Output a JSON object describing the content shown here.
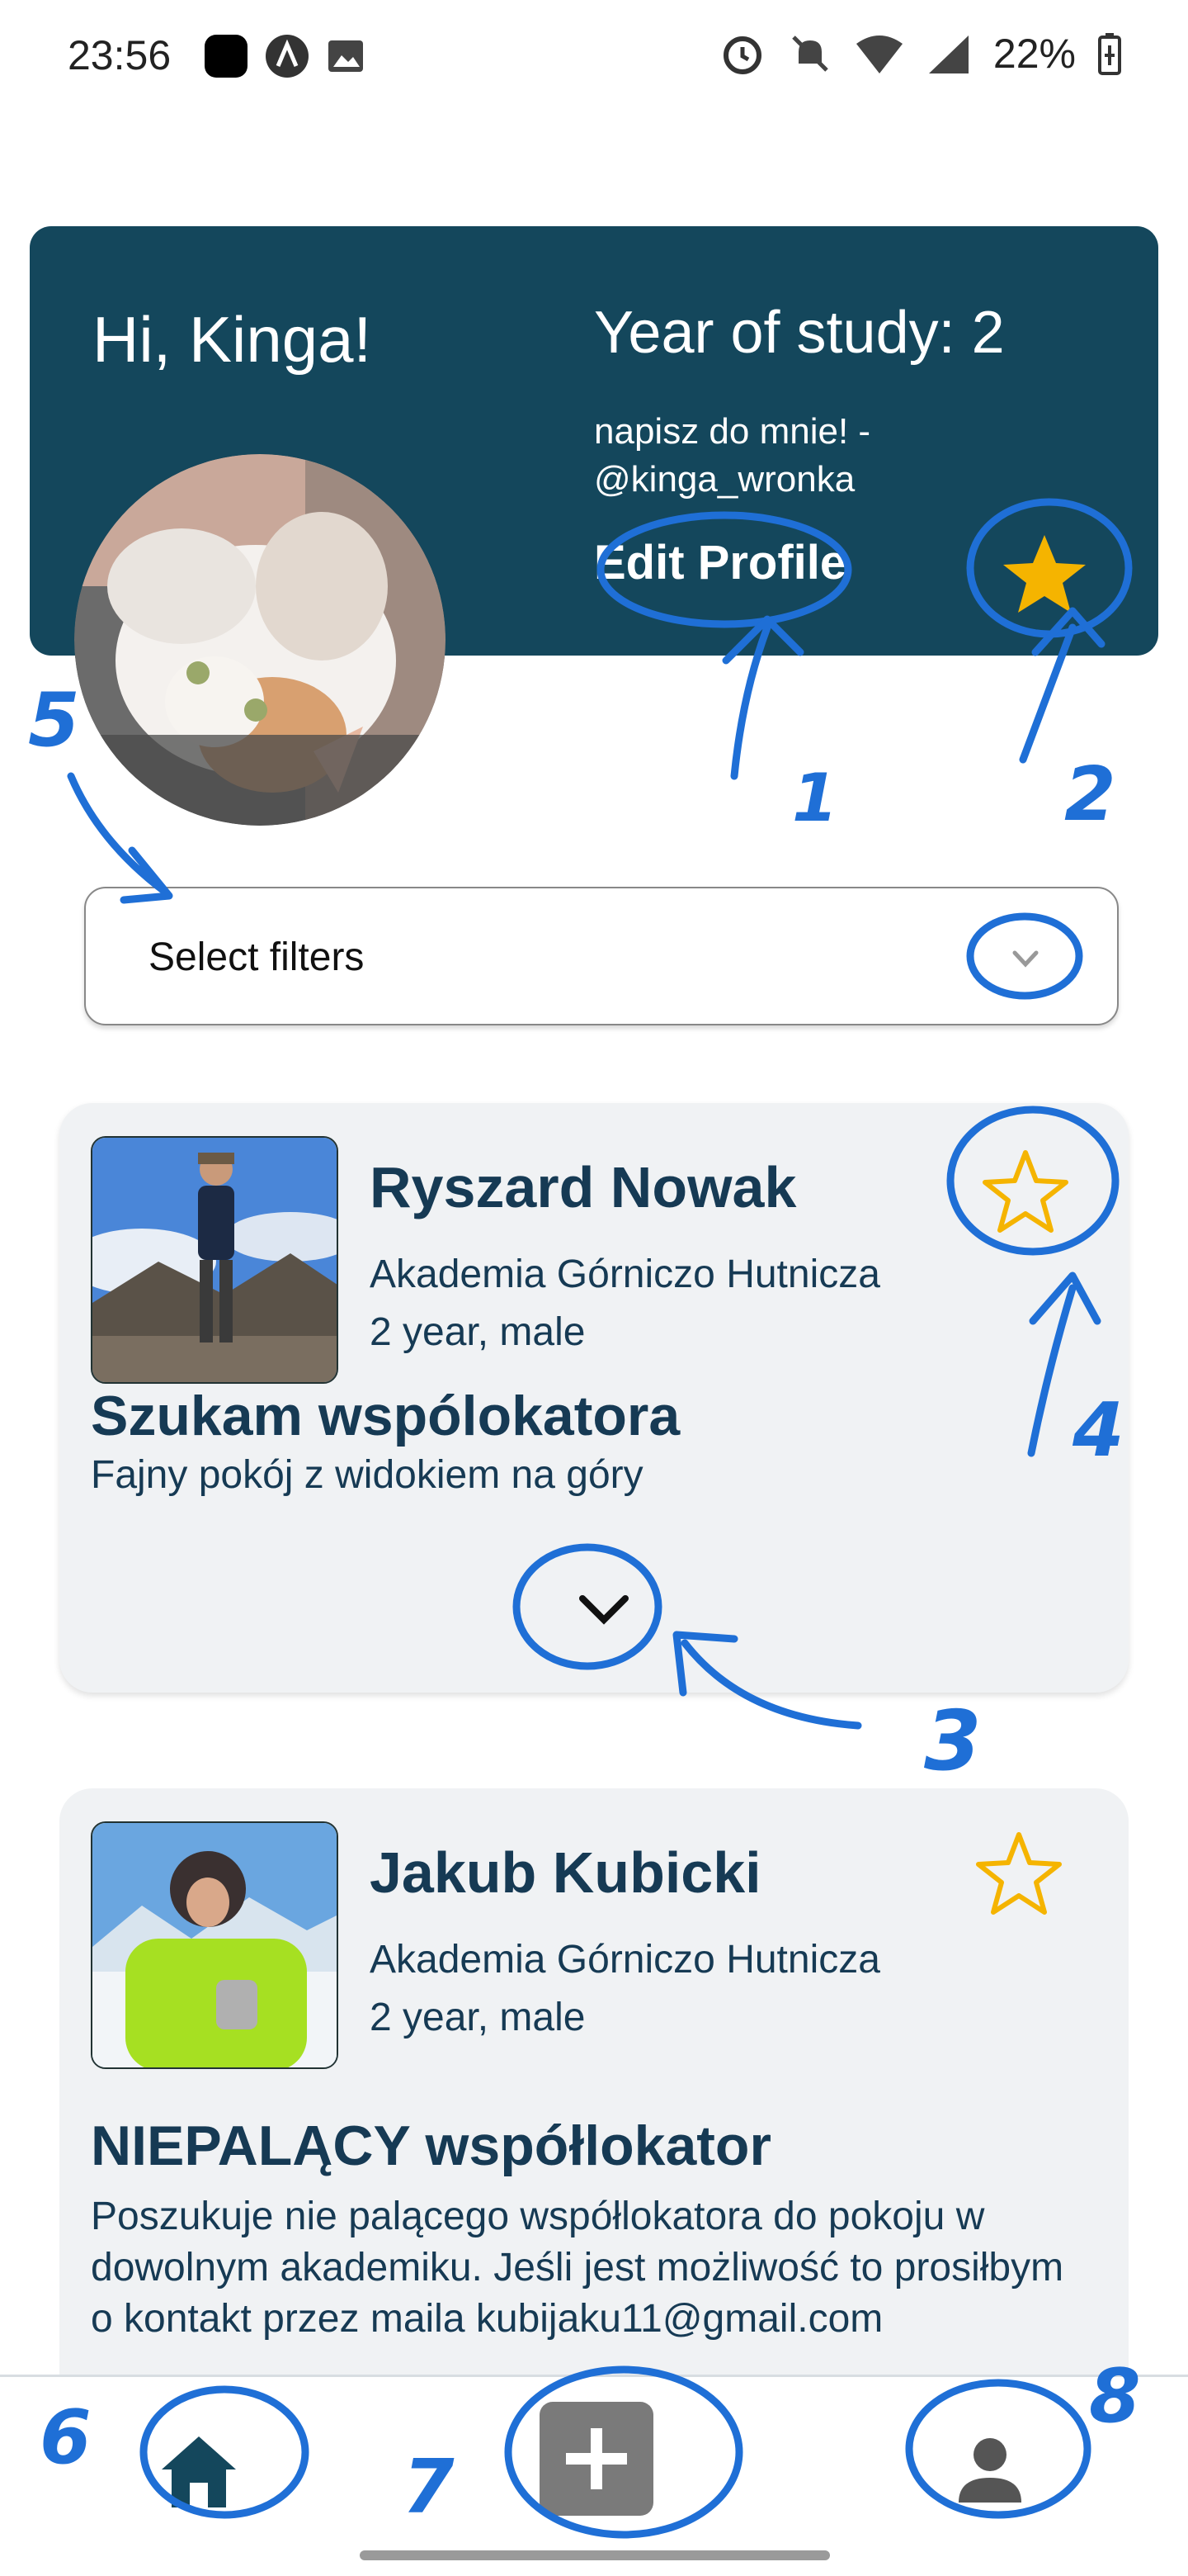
{
  "status_bar": {
    "time": "23:56",
    "battery": "22%",
    "icons": [
      "app-icon",
      "a-icon",
      "image-icon",
      "alarm-icon",
      "bell-off-icon",
      "wifi-icon",
      "signal-icon",
      "battery-charging-icon"
    ]
  },
  "header": {
    "greeting": "Hi, Kinga!",
    "year": "Year of study: 2",
    "contact_line1": "napisz do mnie! -",
    "contact_line2": "@kinga_wronka",
    "edit_profile": "Edit Profile",
    "favorites_icon": "star-filled-icon"
  },
  "filters": {
    "label": "Select filters",
    "icon": "chevron-down-icon"
  },
  "cards": [
    {
      "name": "Ryszard Nowak",
      "university": "Akademia Górniczo Hutnicza",
      "info": "2 year, male",
      "title": "Szukam wspólokatora",
      "description": "Fajny pokój z widokiem na góry",
      "favorite": false
    },
    {
      "name": "Jakub Kubicki",
      "university": "Akademia Górniczo Hutnicza",
      "info": "2 year, male",
      "title": "NIEPALĄCY współlokator",
      "description": "Poszukuje nie palącego współlokatora do pokoju w dowolnym akademiku. Jeśli jest możliwość to prosiłbym o kontakt przez maila kubijaku11@gmail.com",
      "favorite": false
    }
  ],
  "annotations": [
    "1",
    "2",
    "3",
    "4",
    "5",
    "6",
    "7",
    "8"
  ],
  "colors": {
    "header_bg": "#14475c",
    "text_primary": "#163a54",
    "star": "#f5b400",
    "annotation": "#1f6fd6",
    "card_bg": "#f0f2f4"
  },
  "nav": {
    "home_icon": "home-icon",
    "add_icon": "plus-icon",
    "profile_icon": "person-icon"
  }
}
